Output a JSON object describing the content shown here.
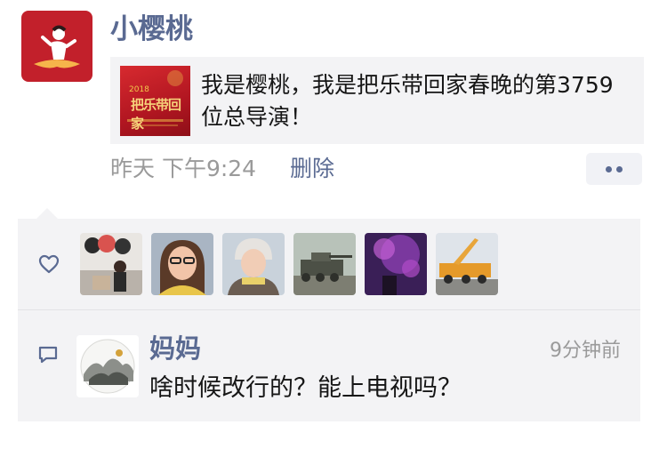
{
  "post": {
    "author": "小樱桃",
    "share_text": "我是樱桃，我是把乐带回家春晚的第3759位总导演！",
    "share_thumb_title": "把乐带回家",
    "share_thumb_year": "2018",
    "time": "昨天 下午9:24",
    "delete_label": "删除"
  },
  "likes": {
    "icon": "heart-outline-icon",
    "avatars": [
      {
        "name": "liker-avatar-1"
      },
      {
        "name": "liker-avatar-2"
      },
      {
        "name": "liker-avatar-3"
      },
      {
        "name": "liker-avatar-4"
      },
      {
        "name": "liker-avatar-5"
      },
      {
        "name": "liker-avatar-6"
      }
    ]
  },
  "comment": {
    "icon": "comment-bubble-icon",
    "author": "妈妈",
    "time": "9分钟前",
    "text": "啥时候改行的？能上电视吗？"
  },
  "colors": {
    "link_blue": "#5a6a92",
    "panel_gray": "#f3f3f5",
    "avatar_red": "#c2202b"
  }
}
